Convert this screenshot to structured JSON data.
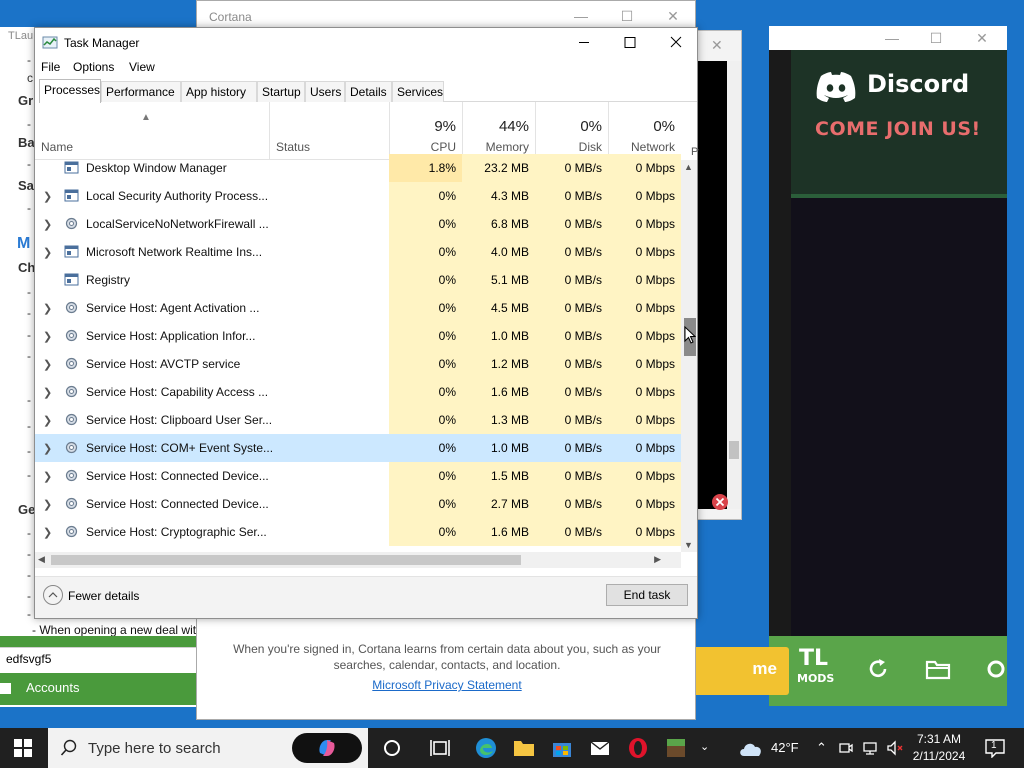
{
  "background_windows": {
    "launcher": {
      "title": "TLau",
      "headings": [
        "Gr",
        "Ba",
        "Sa",
        "Ch",
        "Ge"
      ],
      "blue_heading": "M",
      "footer_text": "- When opening a new deal with",
      "input_value": "edfsvgf5",
      "accounts_label": "Accounts"
    },
    "cortana": {
      "title": "Cortana",
      "info_text": "When you're signed in, Cortana learns from certain data about you, such as your searches, calendar, contacts, and location.",
      "privacy_link": "Microsoft Privacy Statement"
    },
    "game_launcher": {
      "discord_name": "Discord",
      "discord_tagline": "COME JOIN US!",
      "play_label": "me",
      "tl_logo": "TL",
      "mods_logo": "MODS"
    }
  },
  "task_manager": {
    "title": "Task Manager",
    "menu": [
      "File",
      "Options",
      "View"
    ],
    "tabs": [
      "Processes",
      "Performance",
      "App history",
      "Startup",
      "Users",
      "Details",
      "Services"
    ],
    "active_tab": "Processes",
    "columns": {
      "name": "Name",
      "status": "Status",
      "cpu": {
        "pct": "9%",
        "label": "CPU"
      },
      "memory": {
        "pct": "44%",
        "label": "Memory"
      },
      "disk": {
        "pct": "0%",
        "label": "Disk"
      },
      "network": {
        "pct": "0%",
        "label": "Network"
      },
      "power": "Pwr"
    },
    "rows": [
      {
        "name": "Desktop Window Manager",
        "expand": false,
        "icon": "window-icon",
        "cpu": "1.8%",
        "mem": "23.2 MB",
        "disk": "0 MB/s",
        "net": "0 Mbps"
      },
      {
        "name": "Local Security Authority Process...",
        "expand": true,
        "icon": "window-icon",
        "cpu": "0%",
        "mem": "4.3 MB",
        "disk": "0 MB/s",
        "net": "0 Mbps"
      },
      {
        "name": "LocalServiceNoNetworkFirewall ...",
        "expand": true,
        "icon": "gear-icon",
        "cpu": "0%",
        "mem": "6.8 MB",
        "disk": "0 MB/s",
        "net": "0 Mbps"
      },
      {
        "name": "Microsoft Network Realtime Ins...",
        "expand": true,
        "icon": "window-icon",
        "cpu": "0%",
        "mem": "4.0 MB",
        "disk": "0 MB/s",
        "net": "0 Mbps"
      },
      {
        "name": "Registry",
        "expand": false,
        "icon": "window-icon",
        "cpu": "0%",
        "mem": "5.1 MB",
        "disk": "0 MB/s",
        "net": "0 Mbps"
      },
      {
        "name": "Service Host: Agent Activation ...",
        "expand": true,
        "icon": "gear-icon",
        "cpu": "0%",
        "mem": "4.5 MB",
        "disk": "0 MB/s",
        "net": "0 Mbps"
      },
      {
        "name": "Service Host: Application Infor...",
        "expand": true,
        "icon": "gear-icon",
        "cpu": "0%",
        "mem": "1.0 MB",
        "disk": "0 MB/s",
        "net": "0 Mbps"
      },
      {
        "name": "Service Host: AVCTP service",
        "expand": true,
        "icon": "gear-icon",
        "cpu": "0%",
        "mem": "1.2 MB",
        "disk": "0 MB/s",
        "net": "0 Mbps"
      },
      {
        "name": "Service Host: Capability Access ...",
        "expand": true,
        "icon": "gear-icon",
        "cpu": "0%",
        "mem": "1.6 MB",
        "disk": "0 MB/s",
        "net": "0 Mbps"
      },
      {
        "name": "Service Host: Clipboard User Ser...",
        "expand": true,
        "icon": "gear-icon",
        "cpu": "0%",
        "mem": "1.3 MB",
        "disk": "0 MB/s",
        "net": "0 Mbps"
      },
      {
        "name": "Service Host: COM+ Event Syste...",
        "expand": true,
        "icon": "gear-icon",
        "cpu": "0%",
        "mem": "1.0 MB",
        "disk": "0 MB/s",
        "net": "0 Mbps",
        "selected": true
      },
      {
        "name": "Service Host: Connected Device...",
        "expand": true,
        "icon": "gear-icon",
        "cpu": "0%",
        "mem": "1.5 MB",
        "disk": "0 MB/s",
        "net": "0 Mbps"
      },
      {
        "name": "Service Host: Connected Device...",
        "expand": true,
        "icon": "gear-icon",
        "cpu": "0%",
        "mem": "2.7 MB",
        "disk": "0 MB/s",
        "net": "0 Mbps"
      },
      {
        "name": "Service Host: Cryptographic Ser...",
        "expand": true,
        "icon": "gear-icon",
        "cpu": "0%",
        "mem": "1.6 MB",
        "disk": "0 MB/s",
        "net": "0 Mbps"
      }
    ],
    "fewer_details": "Fewer details",
    "end_task": "End task"
  },
  "taskbar": {
    "search_placeholder": "Type here to search",
    "temperature": "42°F",
    "time": "7:31 AM",
    "date": "2/11/2024",
    "notification_count": "1"
  },
  "colors": {
    "desktop": "#1b73c8",
    "usage_cell": "#fff4c4",
    "usage_cell_high": "#ffe9a8",
    "selected_row": "#cce8ff",
    "link": "#1b6ac9",
    "game_green": "#5aa54a"
  }
}
